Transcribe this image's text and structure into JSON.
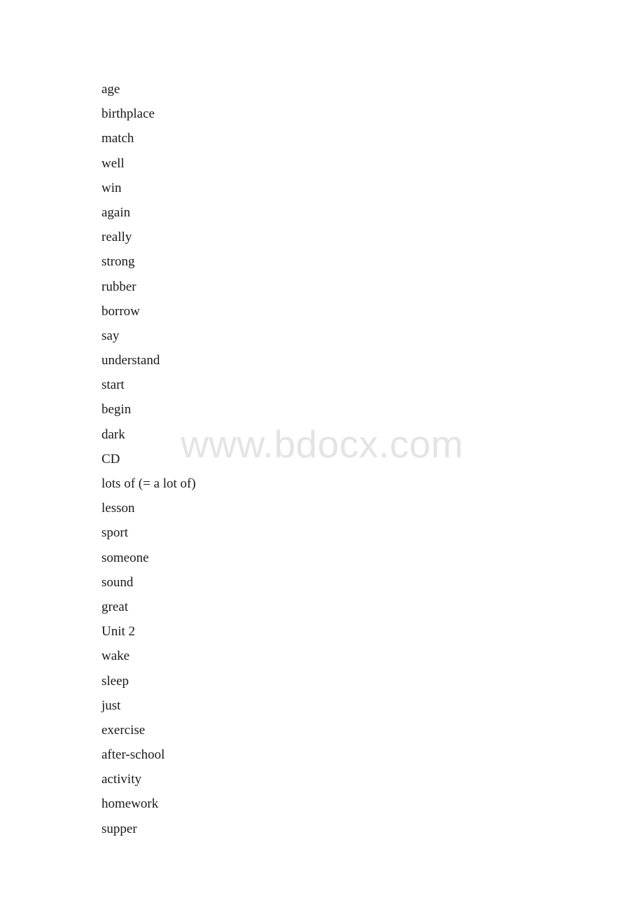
{
  "document": {
    "background_color": "#ffffff",
    "text_color": "#1a1a1a"
  },
  "watermark": {
    "text": "www.bdocx.com",
    "color": "#e4e4e4"
  },
  "word_list": {
    "items": [
      {
        "text": "age"
      },
      {
        "text": "birthplace"
      },
      {
        "text": "match"
      },
      {
        "text": "well"
      },
      {
        "text": "win"
      },
      {
        "text": "again"
      },
      {
        "text": "really"
      },
      {
        "text": "strong"
      },
      {
        "text": "rubber"
      },
      {
        "text": "borrow"
      },
      {
        "text": "say"
      },
      {
        "text": "understand"
      },
      {
        "text": "start"
      },
      {
        "text": "begin"
      },
      {
        "text": "dark"
      },
      {
        "text": "CD"
      },
      {
        "text": "lots of (= a lot of)"
      },
      {
        "text": "lesson"
      },
      {
        "text": "sport"
      },
      {
        "text": "someone"
      },
      {
        "text": "sound"
      },
      {
        "text": "great"
      },
      {
        "text": "Unit 2"
      },
      {
        "text": "wake"
      },
      {
        "text": "sleep"
      },
      {
        "text": "just"
      },
      {
        "text": "exercise"
      },
      {
        "text": "after-school"
      },
      {
        "text": "activity"
      },
      {
        "text": "homework"
      },
      {
        "text": "supper"
      }
    ]
  }
}
